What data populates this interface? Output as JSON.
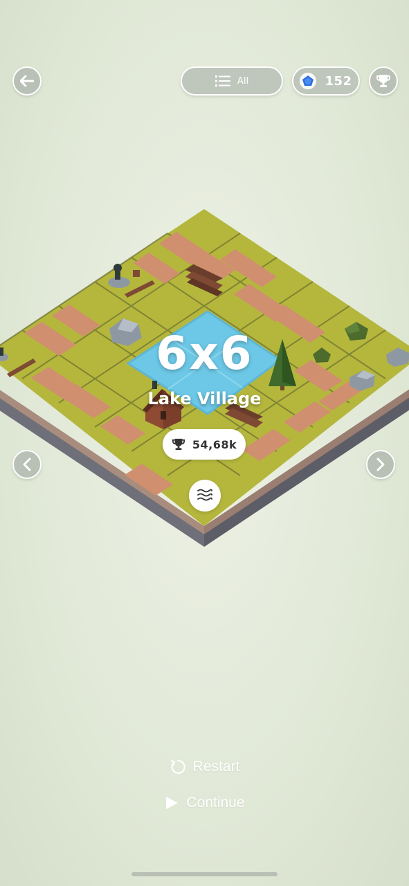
{
  "top_bar": {
    "filter_label": "All",
    "gems": "152"
  },
  "level": {
    "size": "6x6",
    "name": "Lake Village",
    "best_score": "54,68k",
    "biome_icon": "waves-icon"
  },
  "menu": {
    "restart_label": "Restart",
    "continue_label": "Continue"
  },
  "icons": {
    "back": "arrow-left-icon",
    "filter": "list-icon",
    "gem": "pentagon-gem-icon",
    "trophy": "trophy-icon",
    "prev": "chevron-left-icon",
    "next": "chevron-right-icon"
  },
  "colors": {
    "grass": "#b5b73d",
    "path": "#d08f6f",
    "water": "#6cc8e6",
    "gem": "#2d6fe0"
  }
}
